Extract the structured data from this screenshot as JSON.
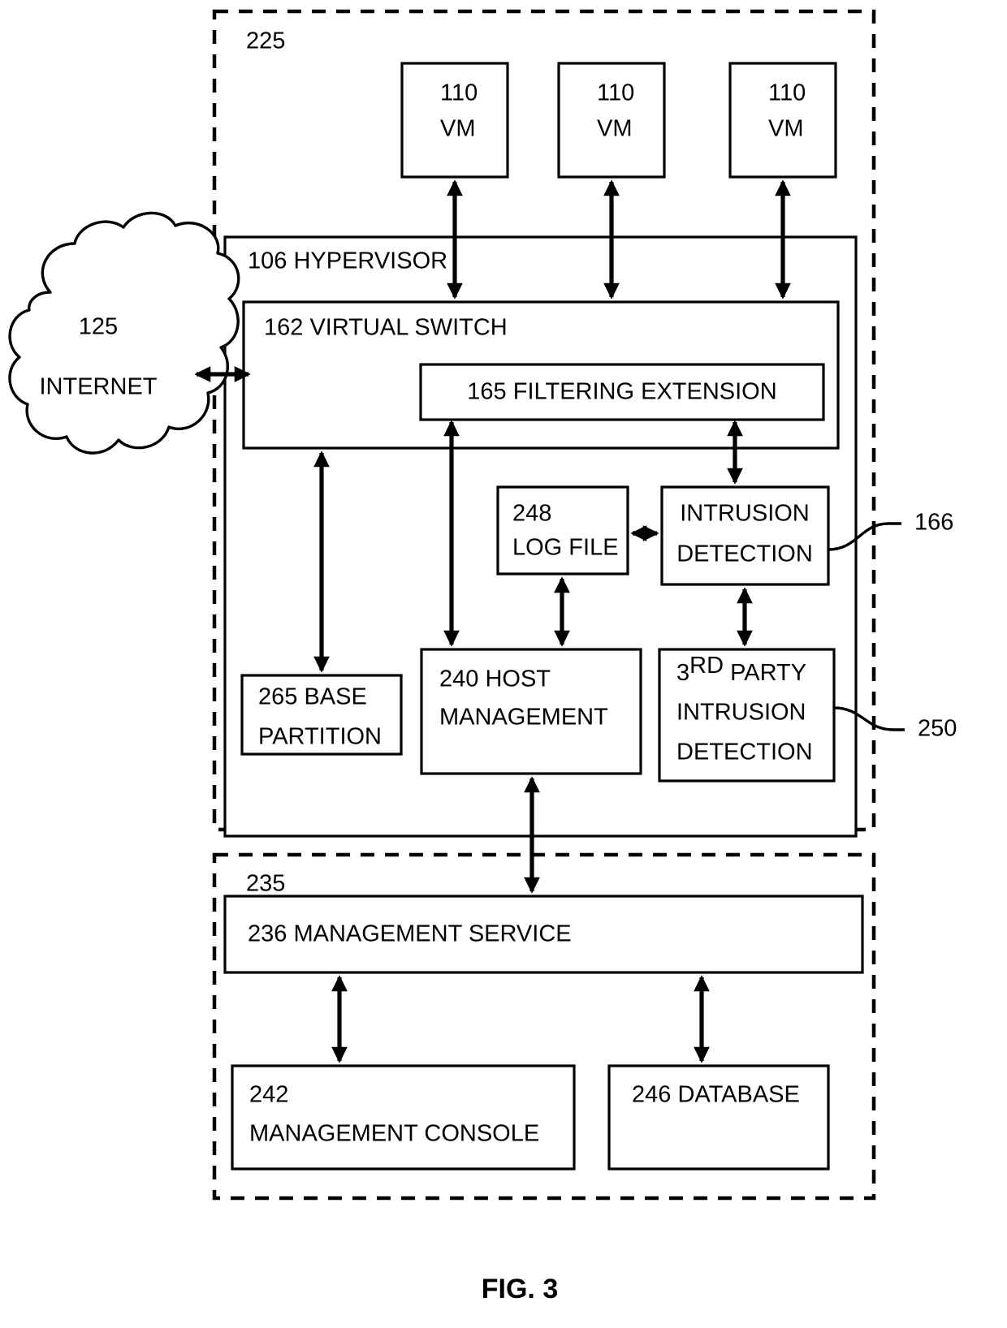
{
  "figure": {
    "caption": "FIG. 3",
    "regions": [
      {
        "id": "host-region",
        "ref": "225"
      },
      {
        "id": "management-region",
        "ref": "235"
      }
    ],
    "cloud": {
      "ref": "125",
      "label": "INTERNET"
    },
    "vms": [
      {
        "ref": "110",
        "label": "VM"
      },
      {
        "ref": "110",
        "label": "VM"
      },
      {
        "ref": "110",
        "label": "VM"
      }
    ],
    "hypervisor": {
      "label": "106 HYPERVISOR"
    },
    "virtual_switch": {
      "label": "162 VIRTUAL SWITCH"
    },
    "filtering_extension": {
      "label": "165 FILTERING EXTENSION"
    },
    "log_file": {
      "line1": "248",
      "line2": "LOG FILE"
    },
    "intrusion_detection": {
      "line1": "INTRUSION",
      "line2": "DETECTION",
      "ref": "166"
    },
    "base_partition": {
      "line1": "265 BASE",
      "line2": "PARTITION"
    },
    "host_management": {
      "line1": "240   HOST",
      "line2": "MANAGEMENT"
    },
    "third_party_intrusion_detection": {
      "line1_num": "3",
      "line1_sup": "RD",
      "line1_rest": " PARTY",
      "line2": "INTRUSION",
      "line3": "DETECTION",
      "ref": "250"
    },
    "management_service": {
      "label": "236 MANAGEMENT SERVICE"
    },
    "management_console": {
      "line1": "242",
      "line2": "MANAGEMENT CONSOLE"
    },
    "database": {
      "label": "246 DATABASE"
    }
  },
  "colors": {
    "stroke": "#000000",
    "fill": "#ffffff"
  }
}
